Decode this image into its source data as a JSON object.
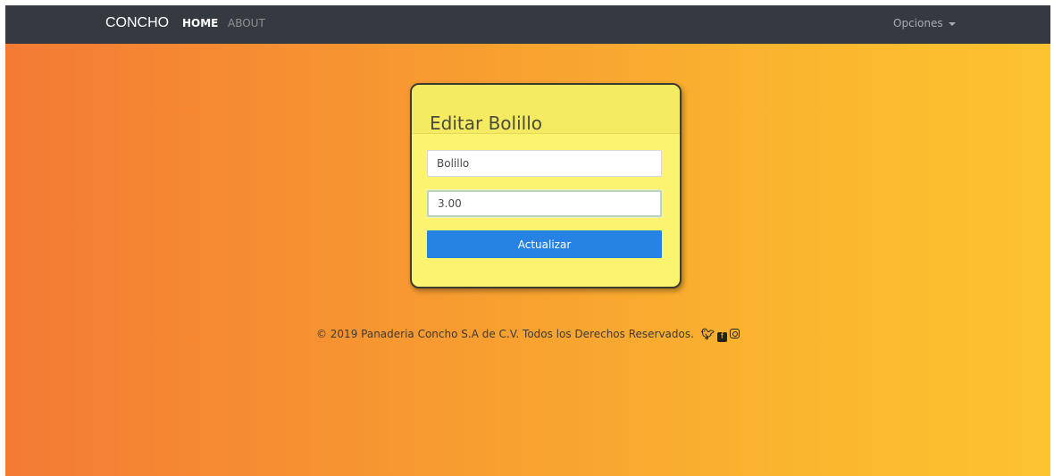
{
  "navbar": {
    "brand": "CONCHO",
    "links": [
      {
        "label": "HOME"
      },
      {
        "label": "ABOUT"
      }
    ],
    "dropdown_label": "Opciones"
  },
  "card": {
    "title": "Editar Bolillo",
    "name_value": "Bolillo",
    "price_value": "3.00",
    "submit_label": "Actualizar"
  },
  "footer": {
    "text": "© 2019 Panaderia Concho S.A de C.V. Todos los Derechos Reservados.",
    "social_icons": [
      "twitter-icon",
      "facebook-icon",
      "instagram-icon"
    ]
  },
  "colors": {
    "navbar_bg": "#343a40",
    "gradient_start": "#f47a34",
    "gradient_end": "#fdc32f",
    "card_bg": "#fcf36e",
    "button_bg": "#2783e3"
  }
}
